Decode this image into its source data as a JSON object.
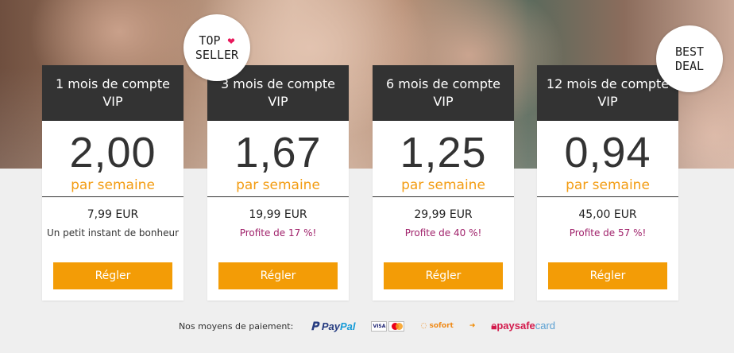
{
  "badges": {
    "top_seller_line1": "TOP",
    "top_seller_line2": "SELLER",
    "heart": "❤",
    "best_deal_line1": "BEST",
    "best_deal_line2": "DEAL"
  },
  "plans": [
    {
      "title_line1": "1 mois de compte",
      "title_line2": "VIP",
      "amount": "2,00",
      "unit": "par semaine",
      "total": "7,99 EUR",
      "note": "Un petit instant de bonheur",
      "button": "Régler"
    },
    {
      "title_line1": "3 mois de compte",
      "title_line2": "VIP",
      "amount": "1,67",
      "unit": "par semaine",
      "total": "19,99 EUR",
      "note": "Profite de 17 %!",
      "button": "Régler"
    },
    {
      "title_line1": "6 mois de compte",
      "title_line2": "VIP",
      "amount": "1,25",
      "unit": "par semaine",
      "total": "29,99 EUR",
      "note": "Profite de 40 %!",
      "button": "Régler"
    },
    {
      "title_line1": "12 mois de compte",
      "title_line2": "VIP",
      "amount": "0,94",
      "unit": "par semaine",
      "total": "45,00 EUR",
      "note": "Profite de 57 %!",
      "button": "Régler"
    }
  ],
  "payment": {
    "label": "Nos moyens de paiement:",
    "paypal_a": "Pay",
    "paypal_b": "Pal",
    "visa": "VISA",
    "sofort": "sofort",
    "giro": "",
    "paysafe_a": "paysafe",
    "paysafe_b": "card"
  },
  "colors": {
    "accent": "#f39c06",
    "header": "#333333",
    "promo": "#a0226b"
  }
}
